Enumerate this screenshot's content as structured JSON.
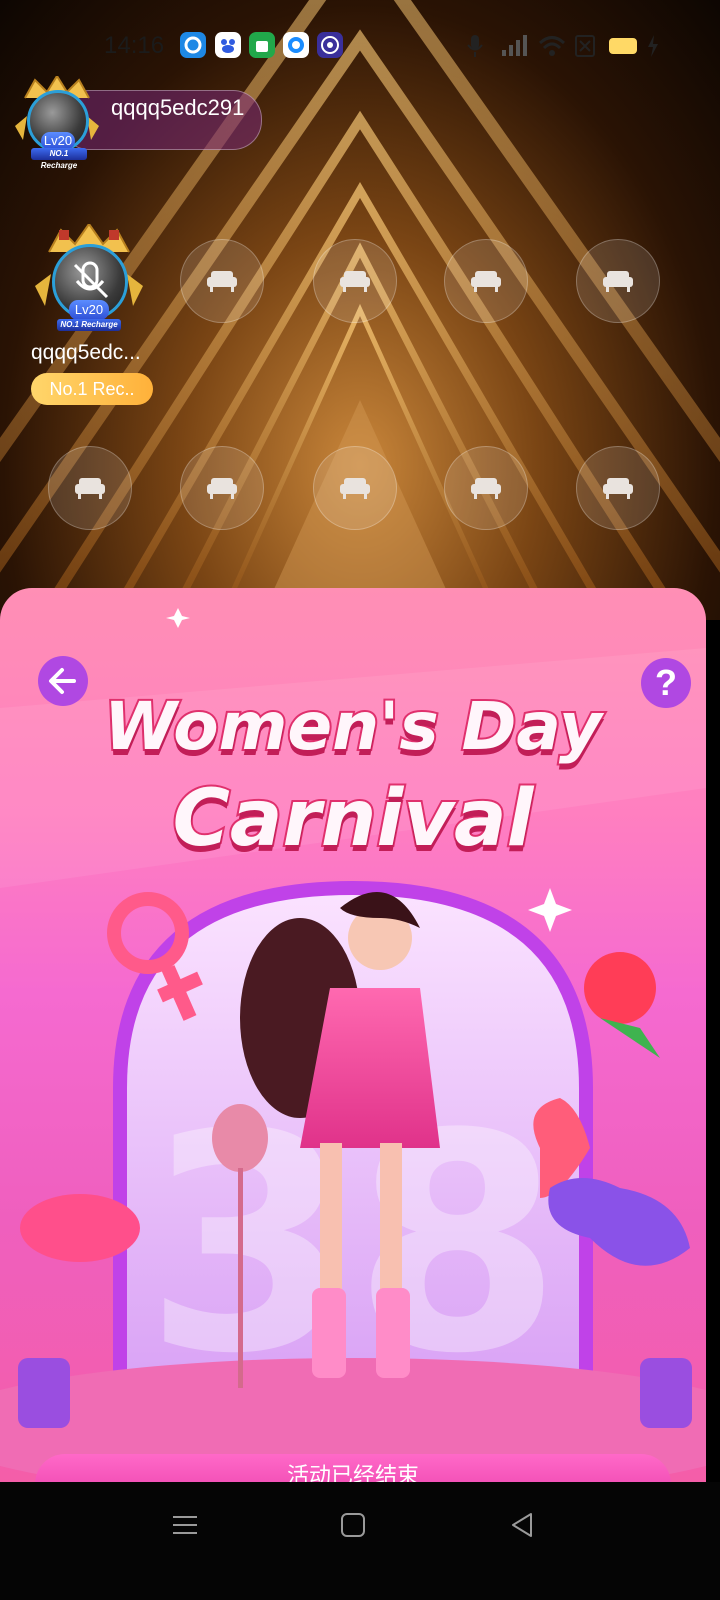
{
  "status_bar": {
    "time": "14:16",
    "app_icons": [
      "circle-app-icon",
      "baidu-icon",
      "android-store-icon",
      "qq-browser-icon",
      "orbit-app-icon"
    ],
    "system_icons": [
      "microphone-icon",
      "signal-icon",
      "wifi-icon",
      "no-sim-icon",
      "battery-icon",
      "charging-icon"
    ]
  },
  "host": {
    "name": "qqqq5edc291",
    "level": "Lv20",
    "rank_label": "NO.1 Recharge"
  },
  "seats": {
    "occupied": {
      "name": "qqqq5edc...",
      "level": "Lv20",
      "rank_label": "NO.1 Recharge",
      "tag": "No.1 Rec.."
    },
    "empty_icon": "sofa-icon"
  },
  "event": {
    "title_line1": "Women's Day",
    "title_line2": "Carnival",
    "end_button_label": "活动已经结束",
    "colors": {
      "accent": "#b048e2",
      "title_stroke": "#e0306d"
    }
  },
  "nav": {
    "items": [
      "menu-icon",
      "home-icon",
      "back-icon"
    ]
  }
}
